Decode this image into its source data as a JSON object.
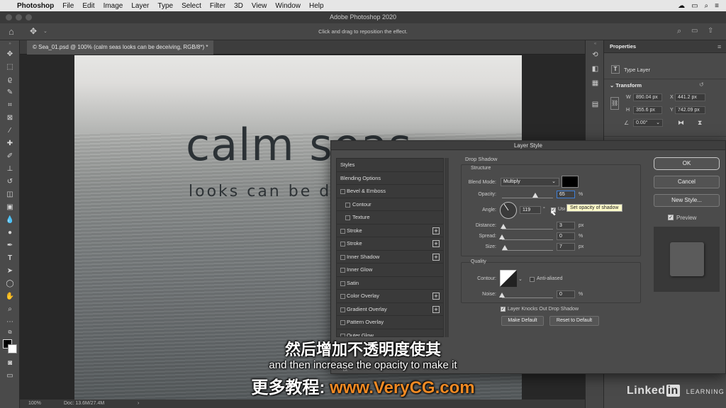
{
  "menubar": {
    "apple": "",
    "app": "Photoshop",
    "items": [
      "File",
      "Edit",
      "Image",
      "Layer",
      "Type",
      "Select",
      "Filter",
      "3D",
      "View",
      "Window",
      "Help"
    ]
  },
  "window_title": "Adobe Photoshop 2020",
  "options_hint": "Click and drag to reposition the effect.",
  "document": {
    "tab": "© Sea_01.psd @ 100% (calm seas looks can be deceiving, RGB/8*) *",
    "headline": "calm seas",
    "subline": "looks can be deceiving"
  },
  "status": {
    "zoom": "100%",
    "doc": "Doc: 13.6M/27.4M",
    "arrow": "›"
  },
  "properties": {
    "title": "Properties",
    "layer_type": "Type Layer",
    "section": "Transform",
    "w": "890.04 px",
    "x": "441.2 px",
    "h": "355.6 px",
    "y": "742.09 px",
    "angle": "0.00°",
    "w_label": "W",
    "x_label": "X",
    "h_label": "H",
    "y_label": "Y"
  },
  "dialog": {
    "title": "Layer Style",
    "styles": [
      {
        "label": "Styles",
        "kind": "head"
      },
      {
        "label": "Blending Options",
        "kind": "head"
      },
      {
        "label": "Bevel & Emboss",
        "kind": "check"
      },
      {
        "label": "Contour",
        "kind": "sub"
      },
      {
        "label": "Texture",
        "kind": "sub"
      },
      {
        "label": "Stroke",
        "kind": "check",
        "plus": true
      },
      {
        "label": "Stroke",
        "kind": "check",
        "plus": true
      },
      {
        "label": "Inner Shadow",
        "kind": "check",
        "plus": true
      },
      {
        "label": "Inner Glow",
        "kind": "check"
      },
      {
        "label": "Satin",
        "kind": "check"
      },
      {
        "label": "Color Overlay",
        "kind": "check",
        "plus": true
      },
      {
        "label": "Gradient Overlay",
        "kind": "check",
        "plus": true
      },
      {
        "label": "Pattern Overlay",
        "kind": "check"
      },
      {
        "label": "Outer Glow",
        "kind": "check"
      }
    ],
    "fx_label": "fx",
    "section_title": "Drop Shadow",
    "structure": "Structure",
    "blend_mode_label": "Blend Mode:",
    "blend_mode": "Multiply",
    "opacity_label": "Opacity:",
    "opacity": "65",
    "angle_label": "Angle:",
    "angle": "119",
    "use_global": "Use Global Light",
    "distance_label": "Distance:",
    "distance": "3",
    "spread_label": "Spread:",
    "spread": "0",
    "size_label": "Size:",
    "size": "7",
    "quality": "Quality",
    "contour_label": "Contour:",
    "anti_aliased": "Anti-aliased",
    "noise_label": "Noise:",
    "noise": "0",
    "knockout": "Layer Knocks Out Drop Shadow",
    "make_default": "Make Default",
    "reset_default": "Reset to Default",
    "ok": "OK",
    "cancel": "Cancel",
    "new_style": "New Style...",
    "preview": "Preview",
    "units": {
      "pct": "%",
      "px": "px",
      "deg": "°"
    },
    "tooltip": "Set opacity of shadow",
    "opacity_fraction": 0.65,
    "distance_fraction": 0.03,
    "spread_fraction": 0.0,
    "size_fraction": 0.05,
    "noise_fraction": 0.0
  },
  "subtitles": {
    "chinese": "然后增加不透明度使其",
    "english": "and then increase the opacity to make it",
    "watermark_cn": "更多教程:",
    "watermark_url": "www.VeryCG.com"
  },
  "branding": {
    "linkedin": "Linked",
    "in": "in",
    "learning": "LEARNING"
  },
  "colors": {
    "accent_watermark": "#f08a24",
    "shadow_swatch": "#000000"
  }
}
